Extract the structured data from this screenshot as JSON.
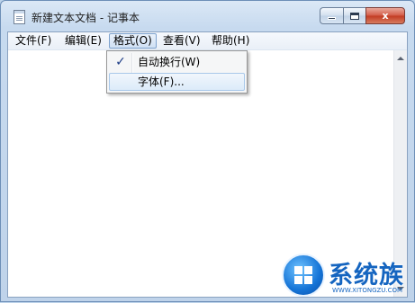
{
  "window": {
    "title": "新建文本文档 - 记事本"
  },
  "menubar": {
    "items": [
      {
        "label": "文件(F)"
      },
      {
        "label": "编辑(E)"
      },
      {
        "label": "格式(O)"
      },
      {
        "label": "查看(V)"
      },
      {
        "label": "帮助(H)"
      }
    ],
    "active": "格式(O)"
  },
  "format_menu": {
    "items": [
      {
        "label": "自动换行(W)",
        "checked": true
      },
      {
        "label": "字体(F)..."
      }
    ]
  },
  "controls": {
    "close_glyph": "x"
  },
  "watermark": {
    "brand": "系统族",
    "url": "WWW.XITONGZU.COM"
  },
  "colors": {
    "frame": "#bfd3ea",
    "menu_highlight": "#cfe0f4",
    "close_button": "#c23a22",
    "check": "#1c3c86",
    "watermark": "#1565c0"
  }
}
